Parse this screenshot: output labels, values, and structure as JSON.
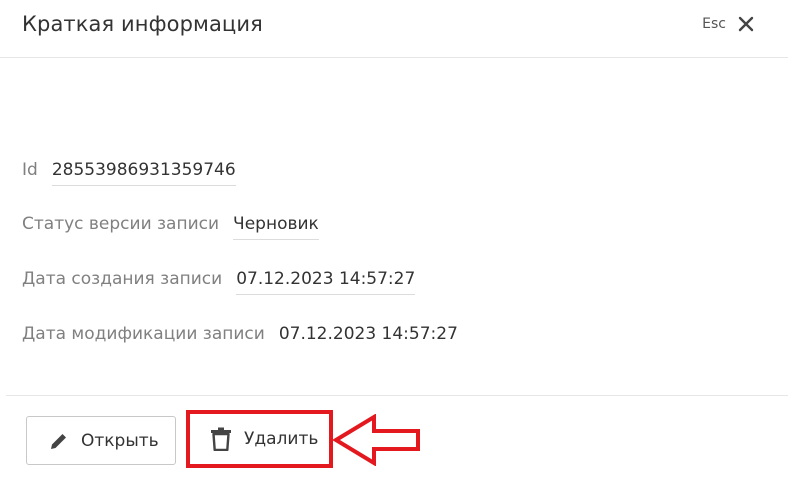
{
  "header": {
    "title": "Краткая информация",
    "esc_label": "Esc"
  },
  "fields": [
    {
      "label": "Id",
      "value": "28553986931359746"
    },
    {
      "label": "Статус версии записи",
      "value": "Черновик"
    },
    {
      "label": "Дата создания записи",
      "value": "07.12.2023 14:57:27"
    },
    {
      "label": "Дата модификации записи",
      "value": "07.12.2023 14:57:27"
    }
  ],
  "footer": {
    "open_label": "Открыть",
    "delete_label": "Удалить"
  },
  "icons": {
    "close": "close-icon",
    "open": "pencil-icon",
    "delete": "trash-icon",
    "annotation": "arrow-left-icon"
  },
  "colors": {
    "annotation": "#e3191f"
  }
}
